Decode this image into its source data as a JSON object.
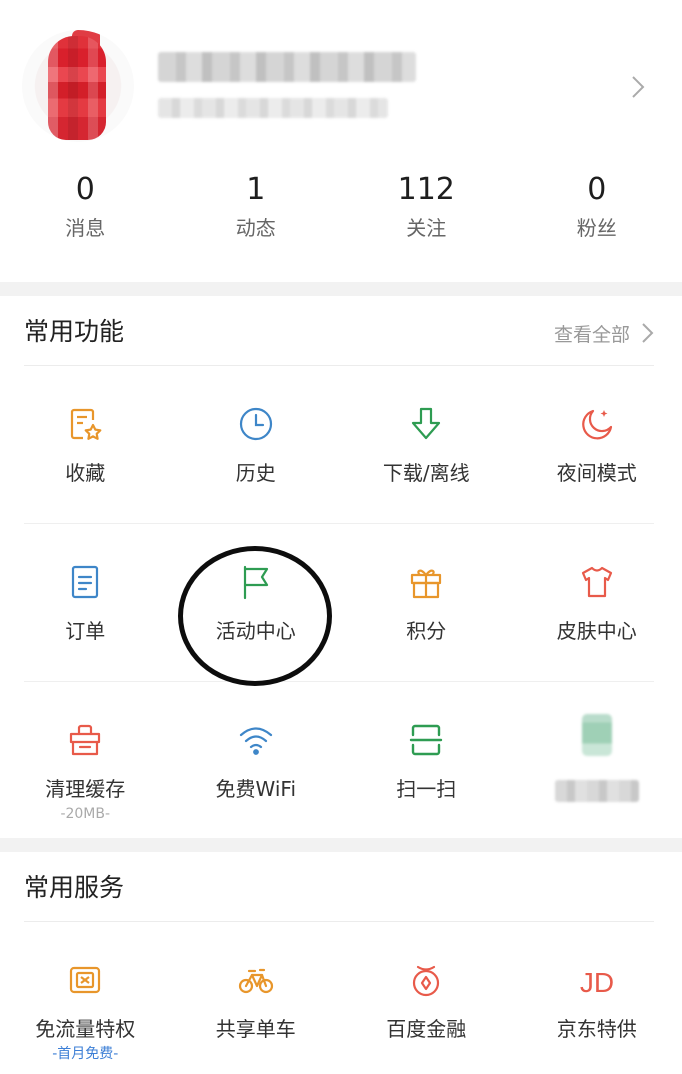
{
  "profile": {
    "stats": [
      {
        "value": "0",
        "label": "消息"
      },
      {
        "value": "1",
        "label": "动态"
      },
      {
        "value": "112",
        "label": "关注"
      },
      {
        "value": "0",
        "label": "粉丝"
      }
    ]
  },
  "common_functions": {
    "title": "常用功能",
    "view_all": "查看全部",
    "items": [
      {
        "label": "收藏",
        "icon": "favorites-icon",
        "color": "#e8962b"
      },
      {
        "label": "历史",
        "icon": "clock-icon",
        "color": "#3e86c8"
      },
      {
        "label": "下载/离线",
        "icon": "download-icon",
        "color": "#2e9c52"
      },
      {
        "label": "夜间模式",
        "icon": "moon-icon",
        "color": "#e85a4a"
      },
      {
        "label": "订单",
        "icon": "order-icon",
        "color": "#3e86c8"
      },
      {
        "label": "活动中心",
        "icon": "flag-icon",
        "color": "#2e9c52"
      },
      {
        "label": "积分",
        "icon": "gift-icon",
        "color": "#e8962b"
      },
      {
        "label": "皮肤中心",
        "icon": "tshirt-icon",
        "color": "#e85a4a"
      },
      {
        "label": "清理缓存",
        "sub": "-20MB-",
        "icon": "basket-icon",
        "color": "#e85a4a"
      },
      {
        "label": "免费WiFi",
        "icon": "wifi-icon",
        "color": "#3e86c8"
      },
      {
        "label": "扫一扫",
        "icon": "scan-icon",
        "color": "#2e9c52"
      }
    ]
  },
  "common_services": {
    "title": "常用服务",
    "items": [
      {
        "label": "免流量特权",
        "sub": "-首月免费-",
        "icon": "sim-card-icon",
        "color": "#e8962b"
      },
      {
        "label": "共享单车",
        "icon": "bicycle-icon",
        "color": "#e8962b"
      },
      {
        "label": "百度金融",
        "icon": "finance-icon",
        "color": "#e85a4a"
      },
      {
        "label": "京东特供",
        "icon": "jd-icon",
        "icon_text": "JD",
        "color": "#e85a4a"
      }
    ]
  }
}
